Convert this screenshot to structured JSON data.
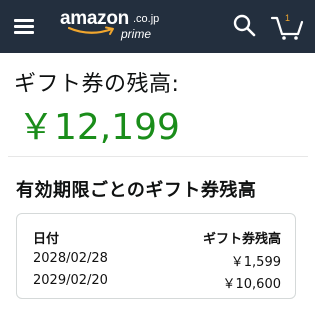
{
  "header": {
    "logo_text": "amazon",
    "logo_tld": ".co.jp",
    "logo_sub": "prime",
    "cart_count": "1",
    "icons": [
      "menu-icon",
      "search-icon",
      "cart-icon"
    ],
    "colors": {
      "background": "#232f3e",
      "accent": "#f0a62e"
    }
  },
  "balance": {
    "label": "ギフト券の残高:",
    "amount": "￥12,199",
    "color": "#1a8d1a"
  },
  "expiry": {
    "title": "有効期限ごとのギフト券残高",
    "headers": {
      "date": "日付",
      "balance": "ギフト券残高"
    },
    "rows": [
      {
        "date": "2028/02/28",
        "amount": "￥1,599"
      },
      {
        "date": "2029/02/20",
        "amount": "￥10,600"
      }
    ]
  }
}
